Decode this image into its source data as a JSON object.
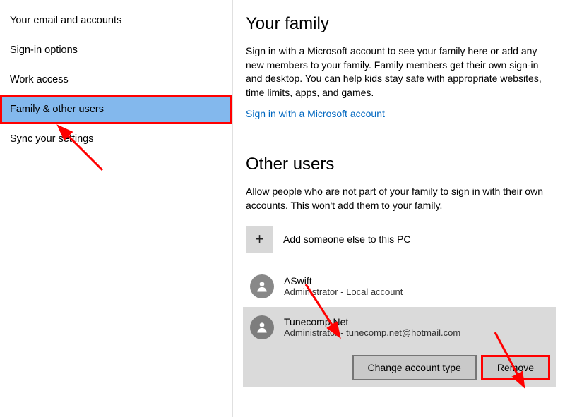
{
  "sidebar": {
    "items": [
      {
        "label": "Your email and accounts"
      },
      {
        "label": "Sign-in options"
      },
      {
        "label": "Work access"
      },
      {
        "label": "Family & other users"
      },
      {
        "label": "Sync your settings"
      }
    ]
  },
  "family": {
    "title": "Your family",
    "desc": "Sign in with a Microsoft account to see your family here or add any new members to your family. Family members get their own sign-in and desktop. You can help kids stay safe with appropriate websites, time limits, apps, and games.",
    "signin_link": "Sign in with a Microsoft account"
  },
  "other": {
    "title": "Other users",
    "desc": "Allow people who are not part of your family to sign in with their own accounts. This won't add them to your family.",
    "add_label": "Add someone else to this PC",
    "users": [
      {
        "name": "ASwift",
        "sub": "Administrator - Local account"
      },
      {
        "name": "Tunecomp Net",
        "sub": "Administrator - tunecomp.net@hotmail.com"
      }
    ],
    "change_type_label": "Change account type",
    "remove_label": "Remove"
  }
}
